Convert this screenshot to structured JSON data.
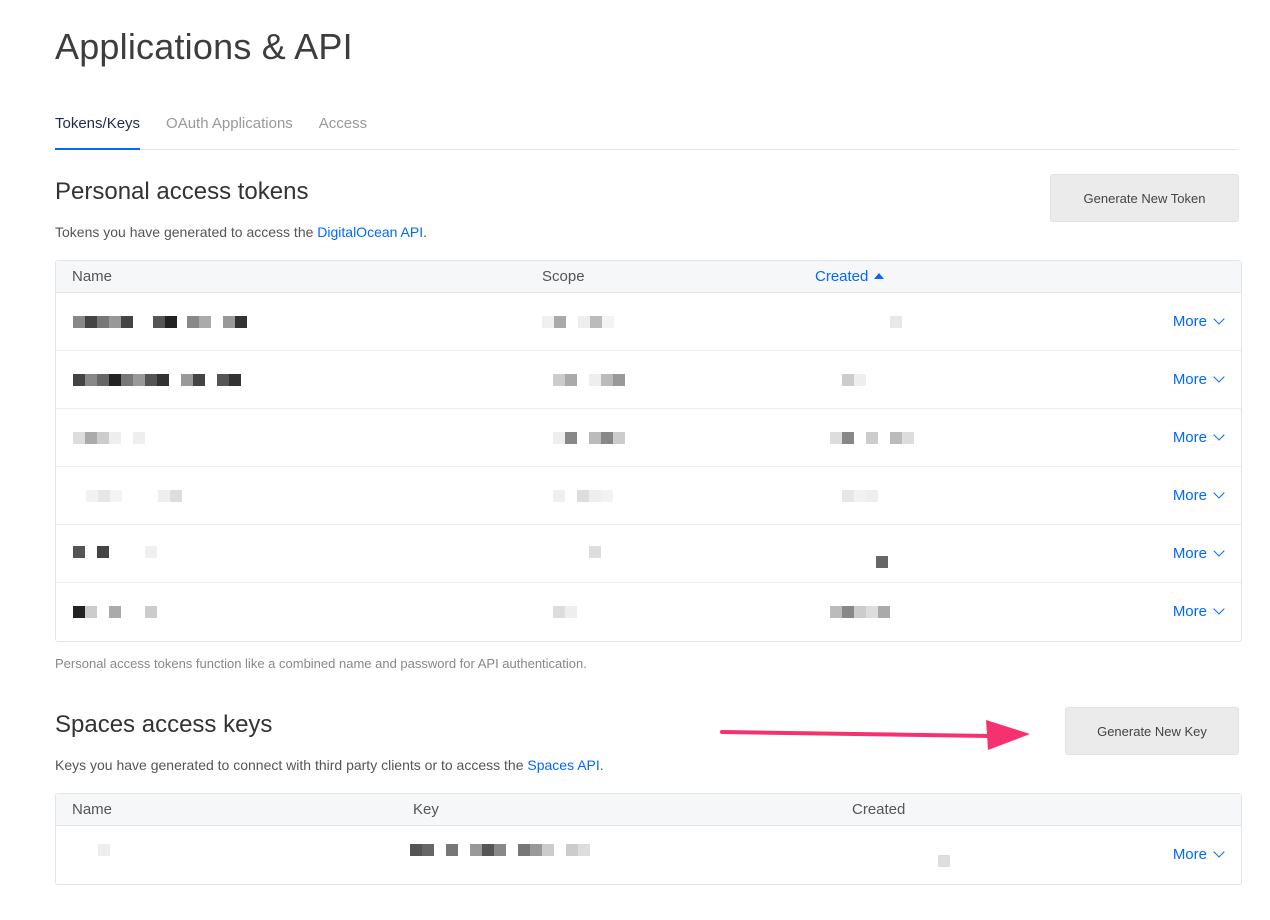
{
  "page": {
    "title": "Applications & API"
  },
  "tabs": [
    {
      "label": "Tokens/Keys",
      "active": true
    },
    {
      "label": "OAuth Applications",
      "active": false
    },
    {
      "label": "Access",
      "active": false
    }
  ],
  "tokens": {
    "title": "Personal access tokens",
    "desc_prefix": "Tokens you have generated to access the ",
    "desc_link": "DigitalOcean API",
    "desc_suffix": ".",
    "button": "Generate New Token",
    "columns": {
      "name": "Name",
      "scope": "Scope",
      "created": "Created"
    },
    "more_label": "More",
    "row_count": 6,
    "footnote": "Personal access tokens function like a combined name and password for API authentication."
  },
  "spaces": {
    "title": "Spaces access keys",
    "desc_prefix": "Keys you have generated to connect with third party clients or to access the ",
    "desc_link": "Spaces API",
    "desc_suffix": ".",
    "button": "Generate New Key",
    "columns": {
      "name": "Name",
      "key": "Key",
      "created": "Created"
    },
    "more_label": "More"
  },
  "colors": {
    "accent": "#0069ff",
    "annotation_arrow": "#f5316f"
  }
}
